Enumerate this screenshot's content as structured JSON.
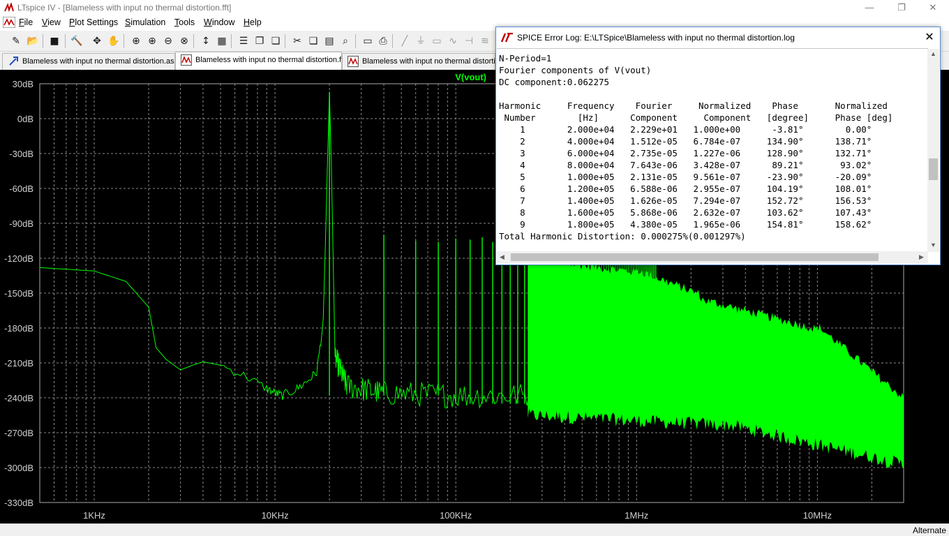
{
  "window": {
    "title": "LTspice IV - [Blameless with input no thermal distortion.fft]"
  },
  "menu": [
    "File",
    "View",
    "Plot Settings",
    "Simulation",
    "Tools",
    "Window",
    "Help"
  ],
  "toolbar": [
    "new-schematic-icon",
    "open-icon",
    "save-icon",
    "control-panel-icon",
    "pan-icon",
    "halt-icon",
    "zoom-in-icon",
    "zoom-area-icon",
    "zoom-out-icon",
    "zoom-fit-icon",
    "autorange-icon",
    "grid-icon",
    "tile-horizontal-icon",
    "cascade-icon",
    "tile-vertical-icon",
    "cut-icon",
    "copy-icon",
    "paste-icon",
    "find-icon",
    "print-setup-icon",
    "print-icon",
    "wire-icon",
    "ground-icon",
    "label-icon",
    "resistor-icon",
    "capacitor-icon",
    "inductor-icon"
  ],
  "tabs": [
    {
      "label": "Blameless with input no thermal distortion.asc",
      "icon": "schematic-icon"
    },
    {
      "label": "Blameless with input no thermal distortion.fft",
      "icon": "waveform-icon"
    },
    {
      "label": "Blameless with input no thermal distortion.",
      "icon": "waveform-icon"
    }
  ],
  "status": {
    "mode": "Alternate"
  },
  "colors": {
    "trace": "#00ff00",
    "background": "#000000",
    "grid": "#8a8a8a"
  },
  "chart_data": {
    "type": "line",
    "trace_label": "V(vout)",
    "x_scale": "log",
    "xlim": [
      500,
      30000000
    ],
    "ylim": [
      -330,
      30
    ],
    "y_ticks": [
      30,
      0,
      -30,
      -60,
      -90,
      -120,
      -150,
      -180,
      -210,
      -240,
      -270,
      -300,
      -330
    ],
    "y_tick_labels": [
      "30dB",
      "0dB",
      "-30dB",
      "-60dB",
      "-90dB",
      "-120dB",
      "-150dB",
      "-180dB",
      "-210dB",
      "-240dB",
      "-270dB",
      "-300dB",
      "-330dB"
    ],
    "x_tick_values": [
      1000,
      10000,
      100000,
      1000000,
      10000000
    ],
    "x_tick_labels": [
      "1KHz",
      "10KHz",
      "100KHz",
      "1MHz",
      "10MHz"
    ],
    "series": [
      {
        "x": [
          500,
          1000,
          1500,
          2000,
          2200,
          2500,
          3000,
          3500,
          4000,
          5000,
          7000,
          9000,
          10000,
          11000,
          13000,
          15000,
          17000,
          18500,
          19500,
          20000,
          20500,
          21500,
          25000,
          40000,
          100000,
          300000,
          500000,
          700000,
          1000000,
          3000000,
          10000000,
          20000000,
          30000000
        ],
        "y": [
          -128,
          -131,
          -140,
          -162,
          -197,
          -207,
          -216,
          -212,
          -209,
          -212,
          -222,
          -232,
          -236,
          -238,
          -233,
          -226,
          -218,
          -175,
          -40,
          23,
          -40,
          -205,
          -230,
          -236,
          -238,
          -238,
          -233,
          -228,
          -226,
          -224,
          -228,
          -238,
          -255
        ]
      }
    ],
    "harmonic_peaks": {
      "x": [
        20000,
        40000,
        60000,
        80000,
        100000,
        120000,
        140000,
        160000,
        180000,
        200000,
        220000,
        240000,
        260000,
        280000,
        300000,
        320000,
        340000,
        360000,
        380000,
        400000
      ],
      "y": [
        23,
        -100,
        -105,
        -106,
        -103,
        -104,
        -102,
        -106,
        -100,
        -97,
        -103,
        -103,
        -96,
        -93,
        -103,
        -106,
        -103,
        -101,
        -98,
        -103
      ]
    }
  },
  "error_log": {
    "title": "SPICE Error Log: E:\\LTSpice\\Blameless with input no thermal distortion.log",
    "lines": [
      "N-Period=1",
      "Fourier components of V(vout)",
      "DC component:0.062275",
      "",
      "Harmonic     Frequency    Fourier     Normalized    Phase       Normalized",
      " Number        [Hz]      Component     Component   [degree]     Phase [deg]",
      "    1        2.000e+04   2.229e+01   1.000e+00      -3.81°        0.00°",
      "    2        4.000e+04   1.512e-05   6.784e-07     134.90°      138.71°",
      "    3        6.000e+04   2.735e-05   1.227e-06     128.90°      132.71°",
      "    4        8.000e+04   7.643e-06   3.428e-07      89.21°       93.02°",
      "    5        1.000e+05   2.131e-05   9.561e-07     -23.90°      -20.09°",
      "    6        1.200e+05   6.588e-06   2.955e-07     104.19°      108.01°",
      "    7        1.400e+05   1.626e-05   7.294e-07     152.72°      156.53°",
      "    8        1.600e+05   5.868e-06   2.632e-07     103.62°      107.43°",
      "    9        1.800e+05   4.380e-05   1.965e-06     154.81°      158.62°",
      "Total Harmonic Distortion: 0.000275%(0.001297%)"
    ]
  }
}
